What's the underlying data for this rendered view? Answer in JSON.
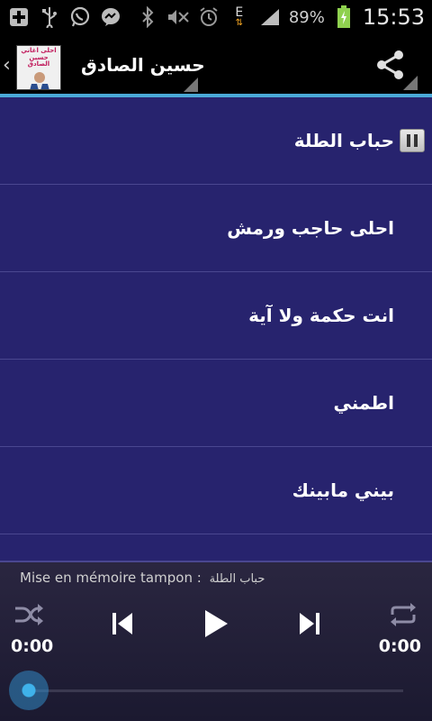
{
  "status_bar": {
    "battery": "89%",
    "clock": "15:53",
    "network_type": "E"
  },
  "action_bar": {
    "title": "حسين الصادق",
    "thumb_caption": "احلى اغاني حسين الصادق"
  },
  "playlist": {
    "items": [
      {
        "label": "حباب الطلة",
        "playing": true
      },
      {
        "label": "احلى حاجب ورمش",
        "playing": false
      },
      {
        "label": "انت حكمة ولا آية",
        "playing": false
      },
      {
        "label": "اطمني",
        "playing": false
      },
      {
        "label": "بيني مابينك",
        "playing": false
      }
    ]
  },
  "player": {
    "buffer_label": "Mise en mémoire tampon :",
    "buffer_track": "حباب الطلة",
    "elapsed": "0:00",
    "duration": "0:00",
    "progress": 0
  },
  "colors": {
    "list_background": "#27236e",
    "accent": "#4aa9d8",
    "seek_knob": "#3fb2ea"
  }
}
